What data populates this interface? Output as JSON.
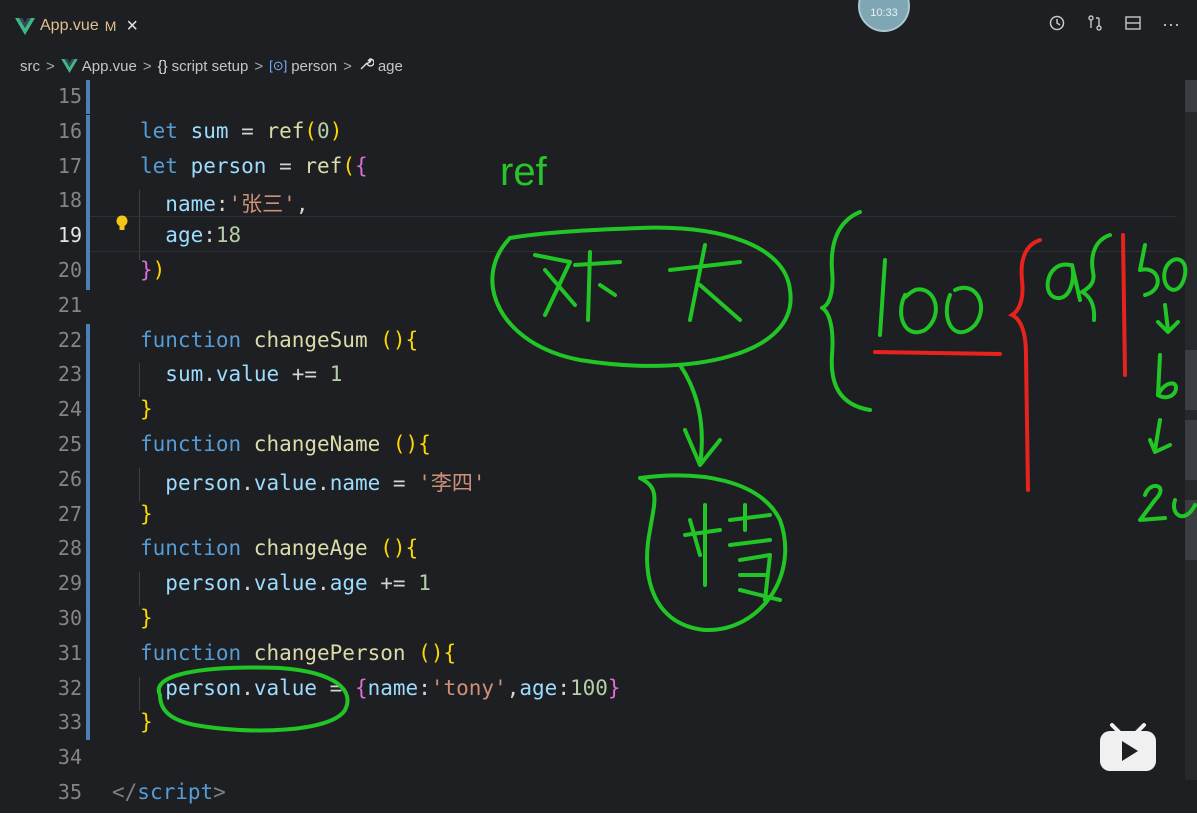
{
  "tab": {
    "filename": "App.vue",
    "modified": "M",
    "close": "×"
  },
  "clock": "10:33",
  "tab_actions": [
    {
      "icon": "history-icon",
      "glyph": "⟲"
    },
    {
      "icon": "compare-changes-icon",
      "glyph": "⇅"
    },
    {
      "icon": "split-editor-icon",
      "glyph": "⊟"
    },
    {
      "icon": "more-icon",
      "glyph": "···"
    }
  ],
  "breadcrumb": {
    "items": [
      "src",
      "App.vue",
      "script setup",
      "person",
      "age"
    ],
    "separator": ">"
  },
  "code_lines": [
    {
      "n": "15",
      "parts": []
    },
    {
      "n": "16",
      "parts": [
        [
          "kw",
          "let "
        ],
        [
          "id",
          "sum"
        ],
        [
          "",
          " = "
        ],
        [
          "fn",
          "ref"
        ],
        [
          "br",
          "("
        ],
        [
          "num",
          "0"
        ],
        [
          "br",
          ")"
        ]
      ]
    },
    {
      "n": "17",
      "parts": [
        [
          "kw",
          "let "
        ],
        [
          "id",
          "person"
        ],
        [
          "",
          " = "
        ],
        [
          "fn",
          "ref"
        ],
        [
          "br",
          "("
        ],
        [
          "br2",
          "{"
        ]
      ]
    },
    {
      "n": "18",
      "parts": [
        [
          "",
          "  "
        ],
        [
          "id",
          "name"
        ],
        [
          "",
          ":"
        ],
        [
          "str",
          "'张三'"
        ],
        [
          "",
          ","
        ]
      ]
    },
    {
      "n": "19",
      "parts": [
        [
          "",
          "  "
        ],
        [
          "id",
          "age"
        ],
        [
          "",
          ":"
        ],
        [
          "num",
          "18"
        ]
      ]
    },
    {
      "n": "20",
      "parts": [
        [
          "br2",
          "}"
        ],
        [
          "br",
          ")"
        ]
      ]
    },
    {
      "n": "21",
      "parts": []
    },
    {
      "n": "22",
      "parts": [
        [
          "kw",
          "function "
        ],
        [
          "fn",
          "changeSum"
        ],
        [
          "",
          " "
        ],
        [
          "br",
          "()"
        ],
        [
          "br",
          "{"
        ]
      ]
    },
    {
      "n": "23",
      "parts": [
        [
          "",
          "  "
        ],
        [
          "id",
          "sum"
        ],
        [
          "",
          "."
        ],
        [
          "id",
          "value"
        ],
        [
          "",
          " += "
        ],
        [
          "num",
          "1"
        ]
      ]
    },
    {
      "n": "24",
      "parts": [
        [
          "br",
          "}"
        ]
      ]
    },
    {
      "n": "25",
      "parts": [
        [
          "kw",
          "function "
        ],
        [
          "fn",
          "changeName"
        ],
        [
          "",
          " "
        ],
        [
          "br",
          "()"
        ],
        [
          "br",
          "{"
        ]
      ]
    },
    {
      "n": "26",
      "parts": [
        [
          "",
          "  "
        ],
        [
          "id",
          "person"
        ],
        [
          "",
          "."
        ],
        [
          "id",
          "value"
        ],
        [
          "",
          "."
        ],
        [
          "id",
          "name"
        ],
        [
          "",
          " = "
        ],
        [
          "str",
          "'李四'"
        ]
      ]
    },
    {
      "n": "27",
      "parts": [
        [
          "br",
          "}"
        ]
      ]
    },
    {
      "n": "28",
      "parts": [
        [
          "kw",
          "function "
        ],
        [
          "fn",
          "changeAge"
        ],
        [
          "",
          " "
        ],
        [
          "br",
          "()"
        ],
        [
          "br",
          "{"
        ]
      ]
    },
    {
      "n": "29",
      "parts": [
        [
          "",
          "  "
        ],
        [
          "id",
          "person"
        ],
        [
          "",
          "."
        ],
        [
          "id",
          "value"
        ],
        [
          "",
          "."
        ],
        [
          "id",
          "age"
        ],
        [
          "",
          " += "
        ],
        [
          "num",
          "1"
        ]
      ]
    },
    {
      "n": "30",
      "parts": [
        [
          "br",
          "}"
        ]
      ]
    },
    {
      "n": "31",
      "parts": [
        [
          "kw",
          "function "
        ],
        [
          "fn",
          "changePerson"
        ],
        [
          "",
          " "
        ],
        [
          "br",
          "()"
        ],
        [
          "br",
          "{"
        ]
      ]
    },
    {
      "n": "32",
      "parts": [
        [
          "",
          "  "
        ],
        [
          "id",
          "person"
        ],
        [
          "",
          "."
        ],
        [
          "id",
          "value"
        ],
        [
          "",
          " = "
        ],
        [
          "br2",
          "{"
        ],
        [
          "id",
          "name"
        ],
        [
          "",
          ":"
        ],
        [
          "str",
          "'tony'"
        ],
        [
          "",
          ","
        ],
        [
          "id",
          "age"
        ],
        [
          "",
          ":"
        ],
        [
          "num",
          "100"
        ],
        [
          "br2",
          "}"
        ]
      ]
    },
    {
      "n": "33",
      "parts": [
        [
          "br",
          "}"
        ]
      ]
    },
    {
      "n": "34",
      "parts": []
    },
    {
      "n": "35",
      "parts": [
        [
          "tag",
          "</"
        ],
        [
          "kw",
          "script"
        ],
        [
          "tag",
          ">"
        ]
      ]
    }
  ],
  "active_line": "19",
  "annotation": {
    "label": "ref"
  },
  "colors": {
    "annotation_green": "#22c526",
    "annotation_red": "#e8231e",
    "editor_bg": "#1e1f22"
  }
}
